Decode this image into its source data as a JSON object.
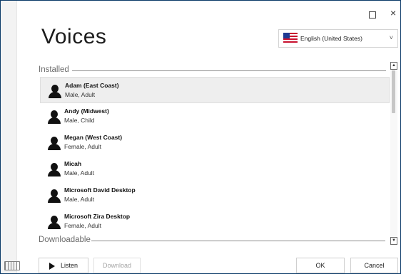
{
  "window": {
    "maximize_glyph": "",
    "close_glyph": "×"
  },
  "header": {
    "title": "Voices"
  },
  "language": {
    "selected": "English (United States)",
    "chevron_glyph": "˅"
  },
  "sections": {
    "installed": "Installed",
    "downloadable": "Downloadable"
  },
  "voices": [
    {
      "name": "Adam (East Coast)",
      "desc": "Male, Adult",
      "selected": true
    },
    {
      "name": "Andy (Midwest)",
      "desc": "Male, Child",
      "selected": false
    },
    {
      "name": "Megan (West Coast)",
      "desc": "Female, Adult",
      "selected": false
    },
    {
      "name": "Micah",
      "desc": "Male, Adult",
      "selected": false
    },
    {
      "name": "Microsoft David Desktop",
      "desc": "Male, Adult",
      "selected": false
    },
    {
      "name": "Microsoft Zira Desktop",
      "desc": "Female, Adult",
      "selected": false
    }
  ],
  "scrollbar": {
    "up_glyph": "▲",
    "down_glyph": "▼"
  },
  "buttons": {
    "listen": "Listen",
    "download": "Download",
    "ok": "OK",
    "cancel": "Cancel"
  },
  "icons": {
    "keyboard": "keyboard-icon",
    "flag": "us-flag-icon",
    "avatar": "person-icon",
    "play": "play-icon"
  }
}
